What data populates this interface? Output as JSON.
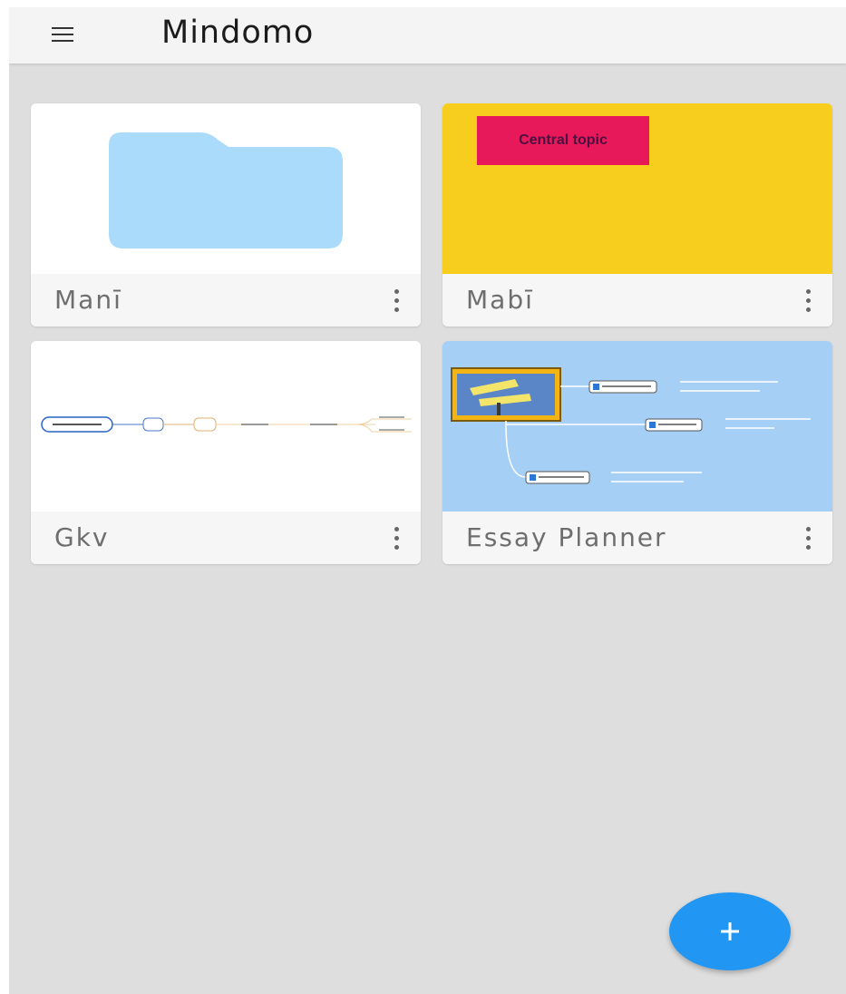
{
  "app": {
    "title": "Mindomo"
  },
  "cards": [
    {
      "title": "Manī",
      "thumbnail": "folder"
    },
    {
      "title": "Mabī",
      "thumbnail": "central-topic",
      "preview_text": "Central topic"
    },
    {
      "title": "Gkv",
      "thumbnail": "mind-map-line"
    },
    {
      "title": "Essay Planner",
      "thumbnail": "mind-map-blue"
    }
  ],
  "colors": {
    "app_bar": "#f4f4f4",
    "background": "#dedede",
    "folder": "#aadbfb",
    "yellow_map": "#f7cd1e",
    "central_topic": "#e8195a",
    "blue_map": "#a6cff6",
    "fab": "#2196f3"
  },
  "icons": {
    "menu": "hamburger-menu-icon",
    "more": "more-vertical-icon",
    "add": "plus-icon"
  }
}
